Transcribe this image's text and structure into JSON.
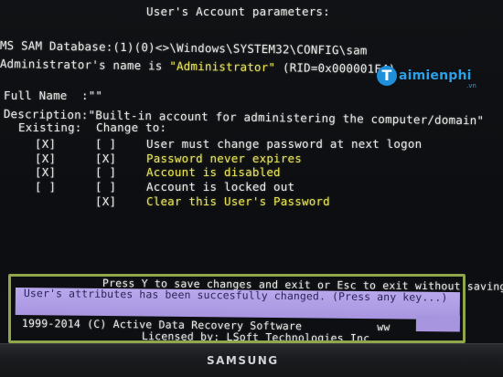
{
  "screen": {
    "title": "User's Account parameters:",
    "sam_database": "MS SAM Database:(1)(0)<>\\Windows\\SYSTEM32\\CONFIG\\sam",
    "admin_prefix": "Administrator's name is ",
    "admin_name": "\"Administrator\"",
    "admin_rid": " (RID=0x000001F4)",
    "full_name": "Full Name  :\"\"",
    "description_prefix": "Description:",
    "description_value": "\"Built-in account for administering the computer/domain\"",
    "column_header": "Existing:  Change to:",
    "options": [
      {
        "existing": "[X]",
        "change": "[ ]",
        "label": "User must change password at next logon",
        "highlight": false
      },
      {
        "existing": "[X]",
        "change": "[X]",
        "label": "Password never expires",
        "highlight": true
      },
      {
        "existing": "[X]",
        "change": "[ ]",
        "label": "Account is disabled",
        "highlight": true
      },
      {
        "existing": "[ ]",
        "change": "[ ]",
        "label": "Account is locked out",
        "highlight": false
      },
      {
        "existing": "",
        "change": "[X]",
        "label": "Clear this User's Password",
        "highlight": true
      }
    ],
    "press_hint": "Press Y to save changes and exit or Esc to exit without saving",
    "status_line1": "User's attributes has been succesfully changed. (Press any key...)",
    "copyright": "1999-2014 (C) Active Data Recovery Software",
    "copyright_tag": "ww",
    "licensed": "Licensed by: LSoft Technologies Inc"
  },
  "watermark": {
    "logo_letter": "T",
    "text": "aimienphi",
    "sub": ".vn",
    "color": "#2aa0e8"
  },
  "monitor": {
    "brand": "SAMSUNG"
  },
  "colors": {
    "text": "#e9e9e6",
    "highlight_text": "#e8e35a",
    "status_bar": "#b9a8ec",
    "annotation_border": "#8fa64a"
  }
}
